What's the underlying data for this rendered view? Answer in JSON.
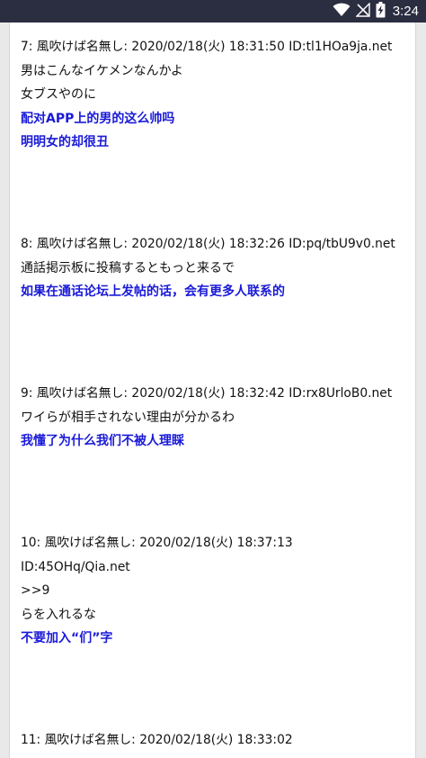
{
  "status_bar": {
    "time": "3:24",
    "battery_level": "battery-charging",
    "icons": [
      "wifi-icon",
      "no-signal-icon",
      "battery-charging-icon"
    ]
  },
  "thread": {
    "posts": [
      {
        "lines": [
          {
            "kind": "meta",
            "text": "7:  風吹けば名無し:  2020/02/18(火) 18:31:50 ID:tl1HOa9ja.net"
          },
          {
            "kind": "jp",
            "text": "男はこんなイケメンなんかよ"
          },
          {
            "kind": "jp",
            "text": "女ブスやのに"
          },
          {
            "kind": "tr",
            "text": "配对APP上的男的这么帅吗"
          },
          {
            "kind": "tr",
            "text": "明明女的却很丑"
          }
        ]
      },
      {
        "lines": [
          {
            "kind": "meta",
            "text": "8:  風吹けば名無し:  2020/02/18(火) 18:32:26 ID:pq/tbU9v0.net"
          },
          {
            "kind": "jp",
            "text": "通話掲示板に投稿するともっと来るで"
          },
          {
            "kind": "tr",
            "text": "如果在通话论坛上发帖的话，会有更多人联系的"
          }
        ]
      },
      {
        "lines": [
          {
            "kind": "meta",
            "text": "9:  風吹けば名無し:  2020/02/18(火) 18:32:42 ID:rx8UrloB0.net"
          },
          {
            "kind": "jp",
            "text": "ワイらが相手されない理由が分かるわ"
          },
          {
            "kind": "tr",
            "text": "我懂了为什么我们不被人理睬"
          }
        ]
      },
      {
        "lines": [
          {
            "kind": "meta",
            "text": "10:  風吹けば名無し:  2020/02/18(火) 18:37:13"
          },
          {
            "kind": "meta",
            "text": "ID:45OHq/Qia.net"
          },
          {
            "kind": "jp",
            "text": ">>9"
          },
          {
            "kind": "jp",
            "text": "らを入れるな"
          },
          {
            "kind": "tr",
            "text": "不要加入“们”字"
          }
        ]
      },
      {
        "lines": [
          {
            "kind": "meta",
            "text": "11:  風吹けば名無し:  2020/02/18(火) 18:33:02"
          }
        ]
      }
    ]
  },
  "colors": {
    "status_bar_bg": "#2b2d41",
    "translation_text": "#1a1ad8",
    "body_text": "#111111",
    "page_bg": "#e9e9e9"
  }
}
